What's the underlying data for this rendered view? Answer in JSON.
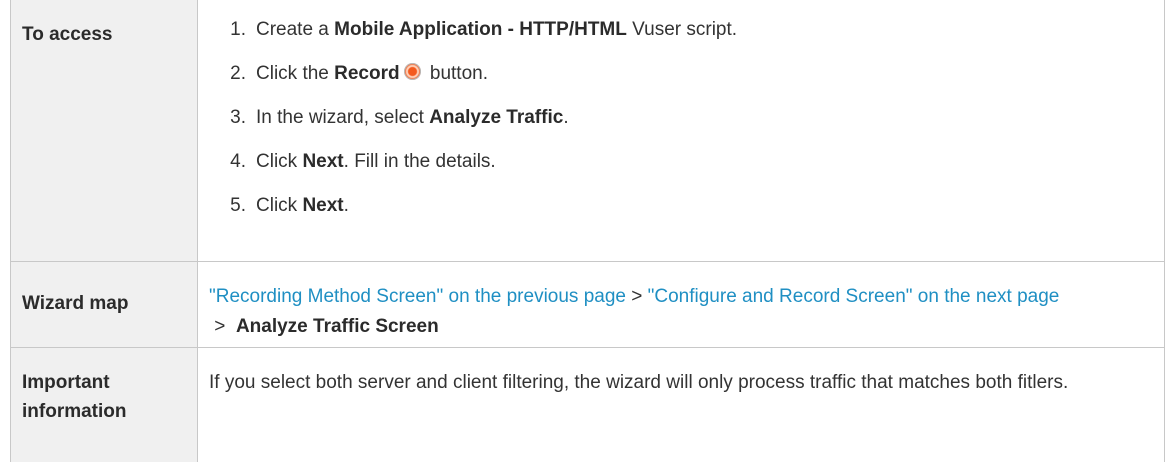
{
  "rows": {
    "access": {
      "label": "To access",
      "steps": [
        {
          "num": "1.",
          "pre": "Create a ",
          "bold": "Mobile Application - HTTP/HTML",
          "post": " Vuser script."
        },
        {
          "num": "2.",
          "pre": "Click the ",
          "bold": "Record",
          "post": " button.",
          "icon": "record-icon"
        },
        {
          "num": "3.",
          "pre": "In the wizard, select ",
          "bold": "Analyze Traffic",
          "post": "."
        },
        {
          "num": "4.",
          "pre": "Click ",
          "bold": "Next",
          "post": ". Fill in the details."
        },
        {
          "num": "5.",
          "pre": "Click ",
          "bold": "Next",
          "post": "."
        }
      ]
    },
    "wizard_map": {
      "label": "Wizard map",
      "link1": "\"Recording Method Screen\" on the previous page",
      "sep1": " > ",
      "link2": "\"Configure and Record Screen\" on the next page",
      "sep2": " >  ",
      "current": "Analyze Traffic Screen"
    },
    "important": {
      "label_line1": "Important",
      "label_line2": "information",
      "text": "If you select both server and client filtering, the wizard will only process traffic that matches both fitlers."
    }
  },
  "colors": {
    "link": "#1f8fc3",
    "label_bg": "#f0f0f0",
    "border": "#c8c8c8",
    "record_icon": "#f45a1e"
  }
}
